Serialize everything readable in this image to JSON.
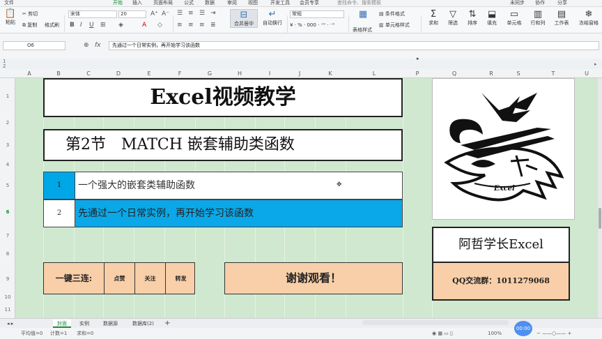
{
  "menu": [
    "文件",
    "开始",
    "插入",
    "页面布局",
    "公式",
    "数据",
    "审阅",
    "视图",
    "开发工具",
    "会员专享",
    "查找命令、搜索模板",
    "未同步",
    "协作",
    "分享"
  ],
  "ribbon": {
    "cut": "剪切",
    "copy": "复制",
    "format_painter": "格式刷",
    "paste": "粘贴",
    "font_name": "宋体",
    "font_size": "20",
    "merge": "合并居中",
    "wrap": "自动换行",
    "number_format": "常规",
    "cond_format": "条件格式",
    "table_style": "表格样式",
    "cell_style": "单元格样式",
    "sum": "求和",
    "filter": "筛选",
    "sort": "排序",
    "fill": "填充",
    "cell": "单元格",
    "rowcol": "行和列",
    "worksheet": "工作表",
    "freeze": "冻结窗格"
  },
  "formula_bar": {
    "name_box": "O6",
    "fx": "fx",
    "content": "先通过一个日常实例，再开始学习该函数"
  },
  "columns": [
    "A",
    "B",
    "C",
    "D",
    "E",
    "F",
    "G",
    "H",
    "I",
    "J",
    "K",
    "L",
    "P",
    "Q",
    "R",
    "S",
    "T",
    "U"
  ],
  "rows": [
    "1",
    "2",
    "3",
    "4",
    "5",
    "6",
    "7",
    "8",
    "9",
    "10",
    "11"
  ],
  "sheet": {
    "title": "Excel视频教学",
    "section": "第2节",
    "section_topic": "MATCH 嵌套辅助类函数",
    "items": [
      {
        "num": "1",
        "text": "一个强大的嵌套类辅助函数"
      },
      {
        "num": "2",
        "text": "先通过一个日常实例，再开始学习该函数"
      }
    ],
    "triple_lead": "一键三连:",
    "triple": [
      "点赞",
      "关注",
      "转发"
    ],
    "thanks": "谢谢观看！",
    "author": "阿哲学长Excel",
    "qq": "QQ交流群：1011279068",
    "logo_text": "Excel"
  },
  "tabs": [
    "封面",
    "实例",
    "数据源",
    "数据库(2)"
  ],
  "status": {
    "avg": "平均值=0",
    "count": "计数=1",
    "sum": "求和=0",
    "zoom": "100%",
    "timer": "00:00"
  },
  "colors": {
    "sheet_bg": "#cfe8cf",
    "highlight_blue": "#00a7e6",
    "peach": "#f8cfa8"
  }
}
